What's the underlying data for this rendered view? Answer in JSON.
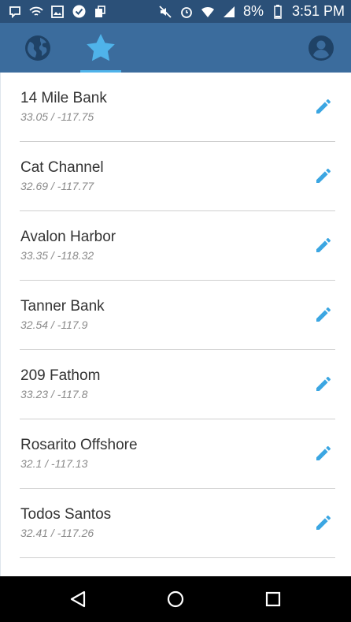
{
  "status_bar": {
    "battery": "8%",
    "time": "3:51 PM",
    "icons": [
      "notification-icon",
      "wifi-call-icon",
      "image-icon",
      "check-icon",
      "app-icon",
      "mute-icon",
      "alarm-icon",
      "wifi-icon",
      "signal-icon",
      "battery-icon"
    ]
  },
  "toolbar": {
    "tabs": [
      {
        "icon": "globe-icon",
        "active": false
      },
      {
        "icon": "star-icon",
        "active": true
      },
      {
        "icon": "account-icon",
        "active": false
      }
    ],
    "colors": {
      "bar": "#3b6c9d",
      "status": "#2b5078",
      "accent": "#4fb3ea"
    }
  },
  "locations": [
    {
      "name": "14 Mile Bank",
      "coords": "33.05 / -117.75"
    },
    {
      "name": "Cat Channel",
      "coords": "32.69 / -117.77"
    },
    {
      "name": "Avalon Harbor",
      "coords": "33.35 / -118.32"
    },
    {
      "name": "Tanner Bank",
      "coords": "32.54 / -117.9"
    },
    {
      "name": "209 Fathom",
      "coords": "33.23 / -117.8"
    },
    {
      "name": "Rosarito Offshore",
      "coords": "32.1 / -117.13"
    },
    {
      "name": "Todos Santos",
      "coords": "32.41 / -117.26"
    }
  ],
  "nav_bar": {
    "buttons": [
      "back-icon",
      "home-icon",
      "recents-icon"
    ]
  }
}
